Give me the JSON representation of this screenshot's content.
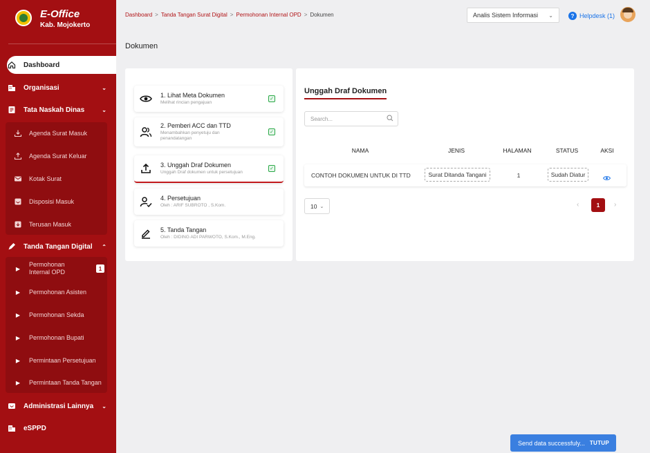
{
  "brand": {
    "title": "E-Office",
    "subtitle": "Kab. Mojokerto"
  },
  "sidebar": {
    "dashboard": "Dashboard",
    "organisasi": "Organisasi",
    "tata_naskah": "Tata Naskah Dinas",
    "tata_sub": [
      "Agenda Surat Masuk",
      "Agenda Surat Keluar",
      "Kotak Surat",
      "Disposisi Masuk",
      "Terusan Masuk"
    ],
    "ttd": "Tanda Tangan Digital",
    "ttd_sub": [
      "Permohonan Internal OPD",
      "Permohonan Asisten",
      "Permohonan Sekda",
      "Permohonan Bupati",
      "Permintaan Persetujuan",
      "Permintaan Tanda Tangan"
    ],
    "ttd_badge": "1",
    "administrasi": "Administrasi Lainnya",
    "esppd": "eSPPD"
  },
  "breadcrumb": [
    "Dashboard",
    "Tanda Tangan Surat Digital",
    "Permohonan Internal OPD",
    "Dokumen"
  ],
  "header": {
    "role": "Analis Sistem Informasi",
    "helpdesk": "Helpdesk (1)"
  },
  "page_title": "Dokumen",
  "steps": [
    {
      "title": "1. Lihat Meta Dokumen",
      "sub": "Melihat rincian pengajuan"
    },
    {
      "title": "2. Pemberi ACC dan TTD",
      "sub": "Menambahkan penyetuju dan penandatangan"
    },
    {
      "title": "3. Unggah Draf Dokumen",
      "sub": "Unggah Draf dokumen untuk persetujuan"
    },
    {
      "title": "4. Persetujuan",
      "sub": "Oleh : ARIF SUBROTO , S.Kom."
    },
    {
      "title": "5. Tanda Tangan",
      "sub": "Oleh : DIDING ADI PARWOTO, S.Kom., M.Eng."
    }
  ],
  "upload": {
    "title": "Unggah Draf Dokumen",
    "search_placeholder": "Search...",
    "columns": [
      "NAMA",
      "JENIS",
      "HALAMAN",
      "STATUS",
      "AKSI"
    ],
    "row": {
      "nama": "CONTOH DOKUMEN UNTUK DI TTD",
      "jenis": "Surat Ditanda Tangani",
      "halaman": "1",
      "status": "Sudah Diatur"
    },
    "page_size": "10",
    "current_page": "1"
  },
  "toast": {
    "message": "Send data successfuly...",
    "close": "TUTUP"
  },
  "colors": {
    "brand": "#a30f12",
    "toast": "#3a7fe0",
    "check": "#27a844"
  }
}
